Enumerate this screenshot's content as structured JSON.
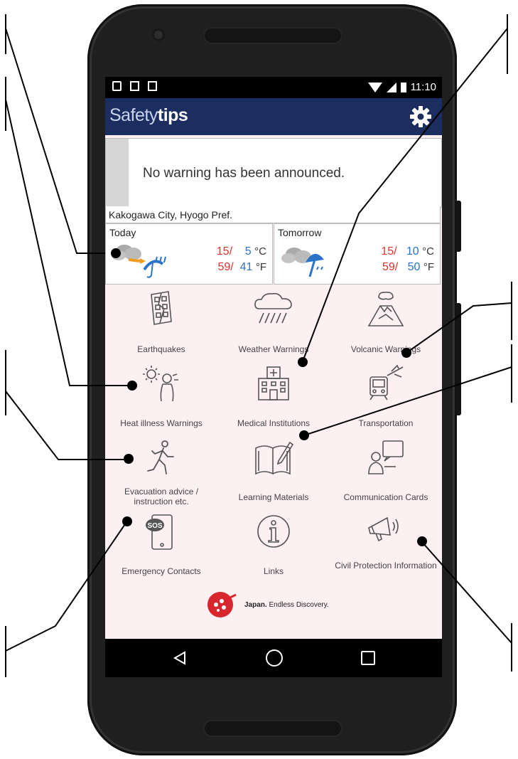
{
  "status_bar": {
    "time": "11:10"
  },
  "app": {
    "title_light": "Safety",
    "title_bold": "tips"
  },
  "warning": {
    "message": "No warning has been announced."
  },
  "location": "Kakogawa City, Hyogo Pref.",
  "forecast": {
    "today": {
      "label": "Today",
      "high_c": "15",
      "low_c": "5",
      "high_f": "59",
      "low_f": "41",
      "icon": "cloud-sun-rain-icon"
    },
    "tomorrow": {
      "label": "Tomorrow",
      "high_c": "15",
      "low_c": "10",
      "high_f": "59",
      "low_f": "50",
      "icon": "cloud-umbrella-icon"
    },
    "unit_c": "°C",
    "unit_f": "°F",
    "sep": "/"
  },
  "menu": [
    {
      "label": "Earthquakes",
      "icon": "earthquake-building-icon"
    },
    {
      "label": "Weather Warnings",
      "icon": "rain-cloud-icon"
    },
    {
      "label": "Volcanic Warnings",
      "icon": "volcano-icon"
    },
    {
      "label": "Heat illness Warnings",
      "icon": "heat-illness-icon"
    },
    {
      "label": "Medical Institutions",
      "icon": "hospital-icon"
    },
    {
      "label": "Transportation",
      "icon": "train-plane-icon"
    },
    {
      "label": "Evacuation advice / instruction etc.",
      "icon": "running-person-icon"
    },
    {
      "label": "Learning Materials",
      "icon": "book-pen-icon"
    },
    {
      "label": "Communication Cards",
      "icon": "speech-card-icon"
    },
    {
      "label": "Emergency Contacts",
      "icon": "sos-phone-icon"
    },
    {
      "label": "Links",
      "icon": "info-icon"
    },
    {
      "label": "Civil Protection Information",
      "icon": "megaphone-icon"
    }
  ],
  "brand": {
    "name": "Japan.",
    "tagline": "Endless Discovery."
  },
  "colors": {
    "appbar": "#1b2e5f",
    "background": "#fdf0f3",
    "temp_high": "#e0312d",
    "temp_low": "#2b72c9"
  }
}
